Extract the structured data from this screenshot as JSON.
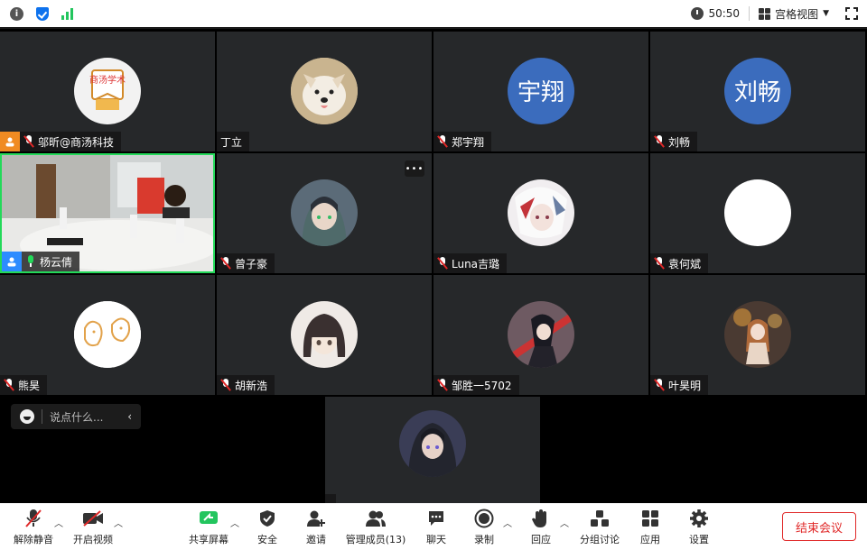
{
  "topbar": {
    "timer": "50:50",
    "view_label": "宫格视图"
  },
  "tiles": [
    {
      "name": "邬昕@商汤科技",
      "avatar_kind": "logo",
      "avatar_text": "商汤学术",
      "host": true
    },
    {
      "name": "丁立",
      "avatar_kind": "dog"
    },
    {
      "name": "郑宇翔",
      "avatar_kind": "text",
      "avatar_text": "宇翔"
    },
    {
      "name": "刘畅",
      "avatar_kind": "text",
      "avatar_text": "刘畅"
    },
    {
      "name": "杨云倩",
      "avatar_kind": "video",
      "active": true
    },
    {
      "name": "曾子豪",
      "avatar_kind": "anime-hood"
    },
    {
      "name": "Luna吉璐",
      "avatar_kind": "anime-white"
    },
    {
      "name": "袁何斌",
      "avatar_kind": "blank"
    },
    {
      "name": "熊昊",
      "avatar_kind": "dogs-drawing"
    },
    {
      "name": "胡新浩",
      "avatar_kind": "anime-girl"
    },
    {
      "name": "邹胜一5702",
      "avatar_kind": "anime-sword"
    },
    {
      "name": "叶昊明",
      "avatar_kind": "anime-autumn"
    },
    {
      "name": "",
      "avatar_kind": "anime-hood-dark"
    }
  ],
  "chat": {
    "placeholder": "说点什么..."
  },
  "toolbar": {
    "mute": "解除静音",
    "video": "开启视频",
    "share": "共享屏幕",
    "security": "安全",
    "invite": "邀请",
    "participants": "管理成员(13)",
    "chat": "聊天",
    "record": "录制",
    "reactions": "回应",
    "breakout": "分组讨论",
    "apps": "应用",
    "settings": "设置",
    "end": "结束会议"
  },
  "colors": {
    "accent": "#2d8cff",
    "active_speaker": "#23d959",
    "end": "#e02828",
    "host": "#f08b22"
  }
}
